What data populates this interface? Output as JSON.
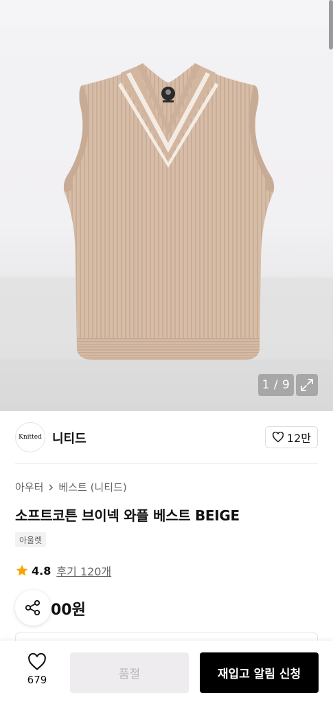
{
  "gallery": {
    "counter": "1 / 9",
    "scroll_icon": "scroll-indicator",
    "expand_icon": "expand-arrows-icon"
  },
  "brand": {
    "logo_text": "Knitted",
    "name": "니티드",
    "like_count": "12만",
    "like_icon": "heart-icon"
  },
  "product": {
    "breadcrumb": [
      "아우터",
      "베스트 (니티드)"
    ],
    "title": "소프트코튼 브이넥 와플 베스트 BEIGE",
    "tag": "아울렛",
    "rating_score": "4.8",
    "review_text": "후기 120개",
    "price": "00원",
    "star_color": "#f7a400"
  },
  "bottom_bar": {
    "wish_count": "679",
    "soldout_label": "품절",
    "restock_label": "재입고 알림 신청"
  },
  "colors": {
    "vest": "#d9bfaa",
    "stripe": "#f4ece3",
    "accent": "#000000"
  }
}
